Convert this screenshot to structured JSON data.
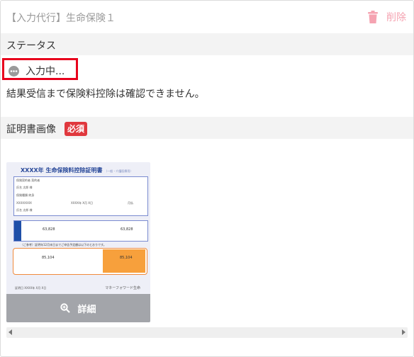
{
  "header": {
    "title": "【入力代行】生命保険１",
    "delete_label": "削除"
  },
  "status_section": {
    "heading": "ステータス",
    "status": "入力中...",
    "note": "結果受信まで保険料控除は確認できません。"
  },
  "certificate_section": {
    "heading": "証明書画像",
    "required_badge": "必須"
  },
  "thumbnail": {
    "doc_title": "XXXX年 生命保険料控除証明書",
    "doc_subtitle": "（一般・介護医療用）",
    "rows": [
      "保険契約者 契約者",
      "氏名 太郎 様",
      "保険種類 終身",
      "XXXXXXXX",
      "氏名 太郎 様"
    ],
    "row_right": [
      "XXXX年 X月 X日",
      "月払"
    ],
    "values_top": [
      "63,828",
      "63,828"
    ],
    "note": "（ご参考）証明年12月末日までご申告予定額は以下のとおりです。",
    "values_bottom": [
      "85,104",
      "85,104"
    ],
    "footer_left": "証明日 XXXX年 X月 X日",
    "footer_right": "マネーフォワード生命",
    "detail_label": "詳細"
  },
  "colors": {
    "accent_red": "#e0383e",
    "delete_pink": "#f5a3b1",
    "status_border": "#e8001c"
  }
}
